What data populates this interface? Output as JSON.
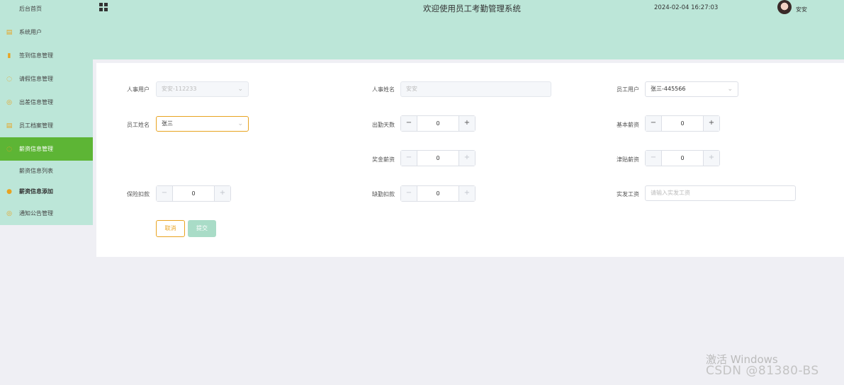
{
  "sidebar": {
    "items": [
      {
        "label": "后台首页",
        "icon": "home-icon"
      },
      {
        "label": "系统用户",
        "icon": "document-icon"
      },
      {
        "label": "签到信息管理",
        "icon": "bar-chart-icon"
      },
      {
        "label": "请假信息管理",
        "icon": "chat-icon"
      },
      {
        "label": "出差信息管理",
        "icon": "check-circle-icon"
      },
      {
        "label": "员工档案管理",
        "icon": "document-icon"
      },
      {
        "label": "薪资信息管理",
        "icon": "chat-icon"
      },
      {
        "label": "薪资信息列表",
        "icon": ""
      },
      {
        "label": "薪资信息添加",
        "icon": "location-pin-icon"
      },
      {
        "label": "通知公告管理",
        "icon": "check-circle-icon"
      }
    ]
  },
  "header": {
    "title": "欢迎使用员工考勤管理系统",
    "datetime": "2024-02-04 16:27:03",
    "username": "安安"
  },
  "form": {
    "hr_user_label": "人事用户",
    "hr_user_value": "安安-112233",
    "hr_name_label": "人事姓名",
    "hr_name_value": "安安",
    "emp_user_label": "员工用户",
    "emp_user_value": "张三-445566",
    "emp_name_label": "员工姓名",
    "emp_name_value": "张三",
    "attend_days_label": "出勤天数",
    "attend_days_value": "0",
    "base_salary_label": "基本薪资",
    "base_salary_value": "0",
    "bonus_label": "奖金薪资",
    "bonus_value": "0",
    "allowance_label": "津贴薪资",
    "allowance_value": "0",
    "insurance_label": "保险扣款",
    "insurance_value": "0",
    "absence_label": "缺勤扣款",
    "absence_value": "0",
    "actual_label": "实发工资",
    "actual_placeholder": "请输入实发工资",
    "cancel_label": "取消",
    "submit_label": "提交"
  },
  "watermark": {
    "line1": "激活 Windows",
    "line2": "CSDN @81380-BS"
  },
  "colors": {
    "sidebar_bg": "#bce6d8",
    "active_bg": "#5db535",
    "accent": "#e8a320",
    "submit_bg": "#a9dcc7"
  }
}
